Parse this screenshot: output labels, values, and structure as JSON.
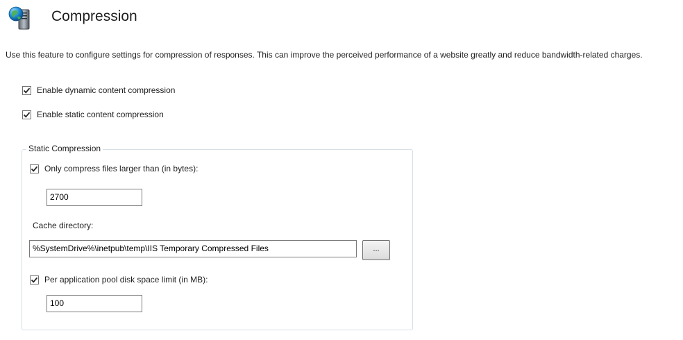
{
  "header": {
    "title": "Compression",
    "icon": "server-globe-icon"
  },
  "description": "Use this feature to configure settings for compression of responses. This can improve the perceived performance of a website greatly and reduce bandwidth-related charges.",
  "options": {
    "dynamic": {
      "label": "Enable dynamic content compression",
      "checked": true
    },
    "static": {
      "label": "Enable static content compression",
      "checked": true
    }
  },
  "static_compression": {
    "legend": "Static Compression",
    "min_size": {
      "label": "Only compress files larger than (in bytes):",
      "checked": true,
      "value": "2700"
    },
    "cache_directory": {
      "label": "Cache directory:",
      "value": "%SystemDrive%\\inetpub\\temp\\IIS Temporary Compressed Files",
      "browse_label": "..."
    },
    "disk_limit": {
      "label": "Per application pool disk space limit (in MB):",
      "checked": true,
      "value": "100"
    }
  },
  "colors": {
    "accent": "#1e8fd6",
    "border": "#d5dfe5"
  }
}
